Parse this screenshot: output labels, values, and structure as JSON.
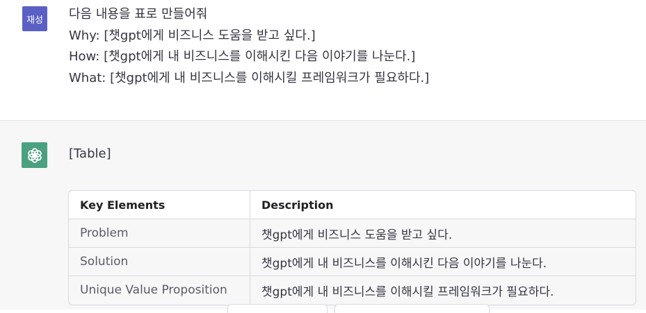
{
  "user": {
    "avatar_label": "재성",
    "avatar_color": "#5b61c4",
    "lines": [
      "다음 내용을 표로 만들어줘",
      "Why: [챗gpt에게 비즈니스 도움을 받고 싶다.]",
      "How: [챗gpt에게 내 비즈니스를 이해시킨 다음 이야기를 나눈다.]",
      "What: [챗gpt에게 내 비즈니스를 이해시킬 프레임워크가 필요하다.]"
    ]
  },
  "assistant": {
    "avatar_icon": "openai-logo-icon",
    "avatar_color": "#4aa180",
    "intro": "[Table]",
    "table": {
      "headers": [
        "Key Elements",
        "Description"
      ],
      "rows": [
        [
          "Problem",
          "챗gpt에게 비즈니스 도움을 받고 싶다."
        ],
        [
          "Solution",
          "챗gpt에게 내 비즈니스를 이해시킨 다음 이야기를 나눈다."
        ],
        [
          "Unique Value Proposition",
          "챗gpt에게 내 비즈니스를 이해시킬 프레임워크가 필요하다."
        ]
      ]
    }
  }
}
